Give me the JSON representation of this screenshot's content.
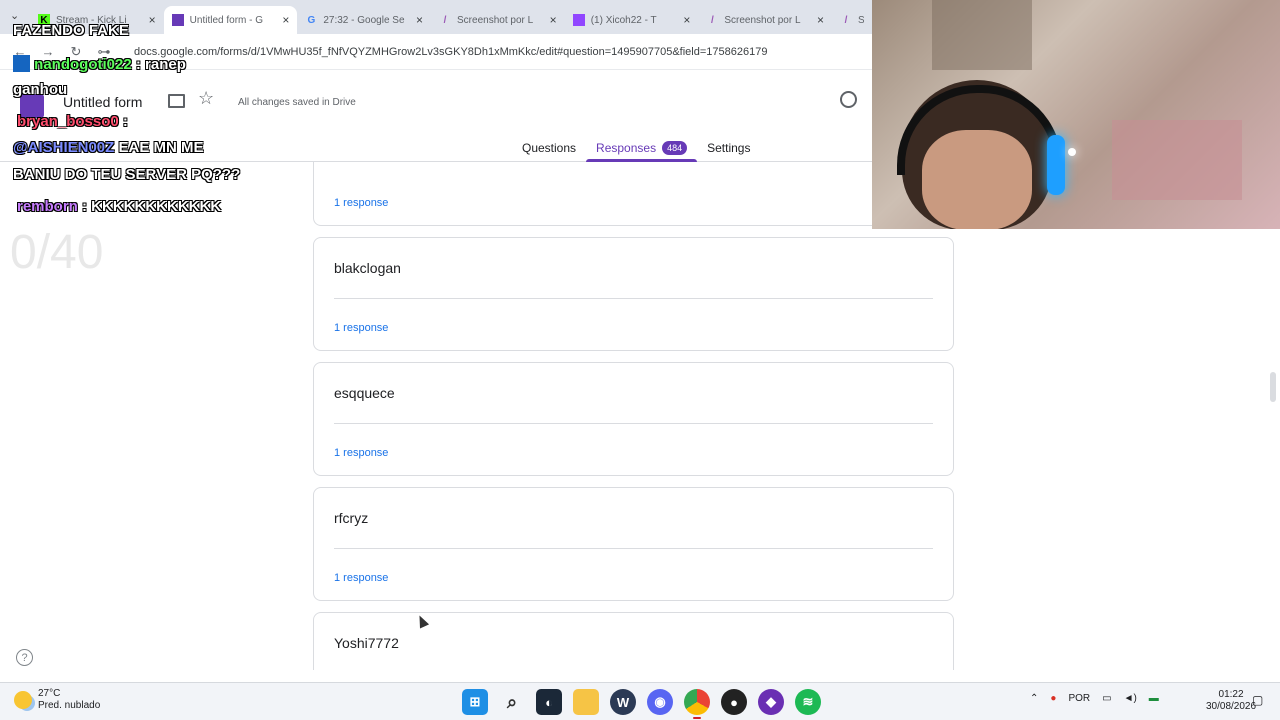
{
  "browser": {
    "tabs": [
      {
        "title": "Stream - Kick Li",
        "favicon_color": "#53fc18",
        "active": false
      },
      {
        "title": "Untitled form - G",
        "favicon_color": "#673ab7",
        "active": true
      },
      {
        "title": "27:32 - Google Se",
        "favicon_color": "#4285f4",
        "active": false
      },
      {
        "title": "Screenshot por L",
        "favicon_color": "#9b59b6",
        "active": false
      },
      {
        "title": "(1) Xicoh22 - T",
        "favicon_color": "#9146ff",
        "active": false
      },
      {
        "title": "Screenshot por L",
        "favicon_color": "#9b59b6",
        "active": false
      },
      {
        "title": "Sc",
        "favicon_color": "#9b59b6",
        "active": false
      }
    ],
    "url": "docs.google.com/forms/d/1VMwHU35f_fNfVQYZMHGrow2Lv3sGKY8Dh1xMmKkc/edit#question=1495907705&field=1758626179"
  },
  "form": {
    "title": "Untitled form",
    "saved_status": "All changes saved in Drive",
    "tabs": [
      {
        "label": "Questions",
        "active": false
      },
      {
        "label": "Responses",
        "active": true,
        "badge": "484"
      },
      {
        "label": "Settings",
        "active": false
      }
    ]
  },
  "cards": [
    {
      "question": "",
      "responses": "1 response"
    },
    {
      "question": "blakclogan",
      "responses": "1 response"
    },
    {
      "question": "esqquece",
      "responses": "1 response"
    },
    {
      "question": "rfcryz",
      "responses": "1 response"
    },
    {
      "question": "Yoshi7772",
      "responses": ""
    }
  ],
  "overlay": {
    "chat": [
      {
        "user": "",
        "text": "FAZENDO FAKE",
        "user_color": "#ffffff"
      },
      {
        "user": "nandogoti022",
        "text": " : ranep",
        "user_color": "#5cff5c"
      },
      {
        "user": "",
        "text": "ganhou",
        "user_color": "#ffffff"
      },
      {
        "user": "bryan_bosso0",
        "text": " :",
        "user_color": "#ff4d6d"
      },
      {
        "user": "@AISHIEN00Z",
        "text": " EAE MN ME",
        "user_color": "#7b8cff"
      },
      {
        "user": "",
        "text": "BANIU DO TEU SERVER PQ???",
        "user_color": "#ffffff"
      },
      {
        "user": "remborn",
        "text": " : KKKKKKKKKKKK",
        "user_color": "#c77dff"
      }
    ],
    "counter": "0/40"
  },
  "taskbar": {
    "temperature": "27°C",
    "weather": "Pred. nublado",
    "language": "POR",
    "time": "01:22",
    "date": "30/08/2026"
  }
}
